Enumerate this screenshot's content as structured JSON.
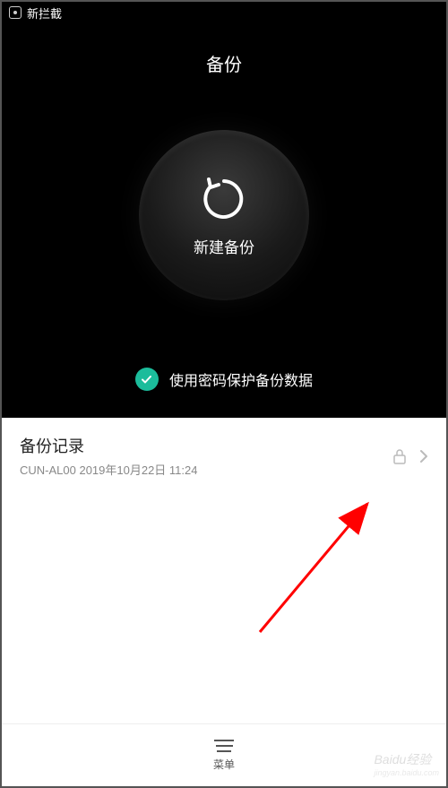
{
  "status_bar": {
    "notification_text": "新拦截"
  },
  "header": {
    "title": "备份"
  },
  "backup_button": {
    "label": "新建备份"
  },
  "password_protect": {
    "label": "使用密码保护备份数据",
    "checked": true
  },
  "backup_record": {
    "title": "备份记录",
    "subtitle": "CUN-AL00  2019年10月22日 11:24"
  },
  "bottom_nav": {
    "menu_label": "菜单"
  },
  "watermark": {
    "main": "Baidu经验",
    "sub": "jingyan.baidu.com"
  }
}
